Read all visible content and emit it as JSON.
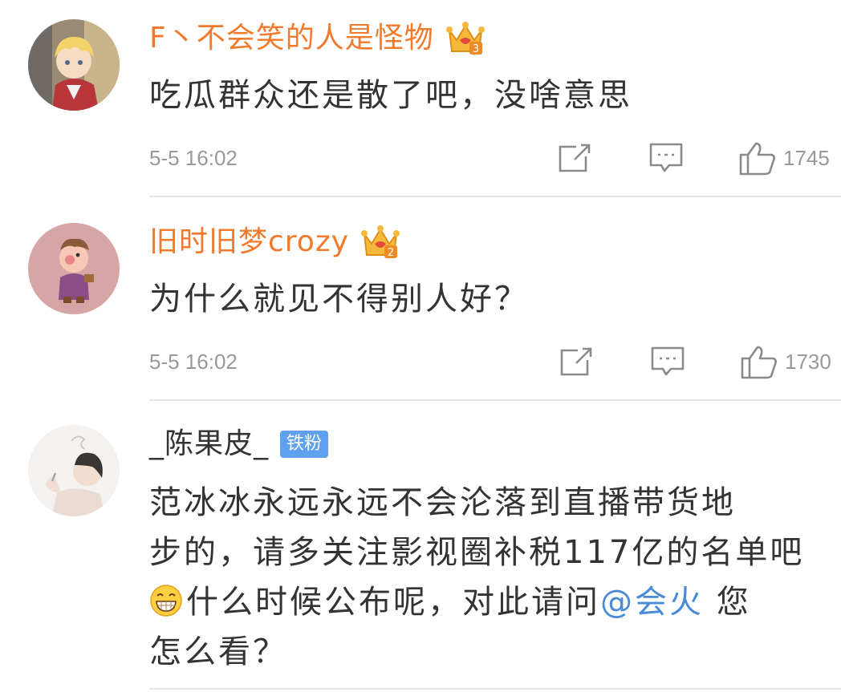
{
  "comments": [
    {
      "username": "F丶不会笑的人是怪物",
      "crown_level": "3",
      "text": "吃瓜群众还是散了吧，没啥意思",
      "time": "5-5 16:02",
      "likes": "1745"
    },
    {
      "username": "旧时旧梦crozy",
      "crown_level": "2",
      "text": "为什么就见不得别人好？",
      "time": "5-5 16:02",
      "likes": "1730"
    },
    {
      "username": "_陈果皮_",
      "badge": "铁粉",
      "text_lines": [
        "范冰冰永远永远不会沦落到直播带货地",
        "步的，请多关注影视圈补税117亿的名单吧",
        "什么时候公布呢，对此请问",
        "怎么看？"
      ],
      "mention": "@会火",
      "after_mention": " 您",
      "emoji": "grinning-face-emoji"
    }
  ],
  "colors": {
    "vip_name": "#f17a2c",
    "mention": "#4a8bd8",
    "fan_badge": "#5ea1ee",
    "meta": "#999999"
  },
  "icons": [
    "crown-icon",
    "share-icon",
    "comment-icon",
    "like-icon"
  ]
}
